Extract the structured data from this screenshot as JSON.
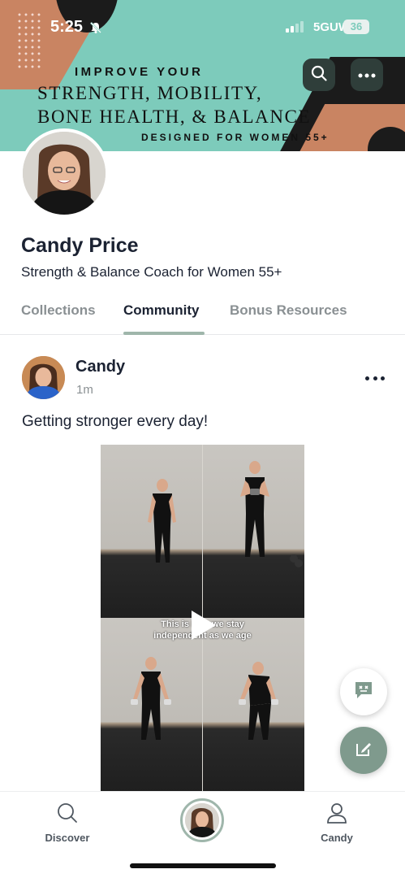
{
  "status_bar": {
    "time": "5:25",
    "network": "5GUW",
    "battery": "36"
  },
  "banner": {
    "line1": "IMPROVE YOUR",
    "line2": "STRENGTH, MOBILITY,",
    "line3": "BONE HEALTH, & BALANCE",
    "line4": "DESIGNED FOR WOMEN 55+",
    "search_icon": "search-icon",
    "more_icon": "ellipsis-icon"
  },
  "profile": {
    "name": "Candy Price",
    "tagline": "Strength & Balance Coach for Women 55+"
  },
  "tabs": [
    {
      "label": "Collections",
      "active": false
    },
    {
      "label": "Community",
      "active": true
    },
    {
      "label": "Bonus Resources",
      "active": false
    }
  ],
  "post": {
    "author": "Candy",
    "time": "1m",
    "text": "Getting stronger every day!",
    "video_caption_line1": "This is how we stay",
    "video_caption_line2": "independent as we age"
  },
  "fabs": {
    "chat_icon": "chat-bubble-icon",
    "compose_icon": "compose-icon"
  },
  "bottom_nav": {
    "discover": "Discover",
    "profile": "Candy"
  },
  "colors": {
    "accent": "#9fb6ab",
    "banner_bg": "#7dcbbb",
    "banner_terracotta": "#c98462",
    "fab_green": "#7f9a8d"
  }
}
